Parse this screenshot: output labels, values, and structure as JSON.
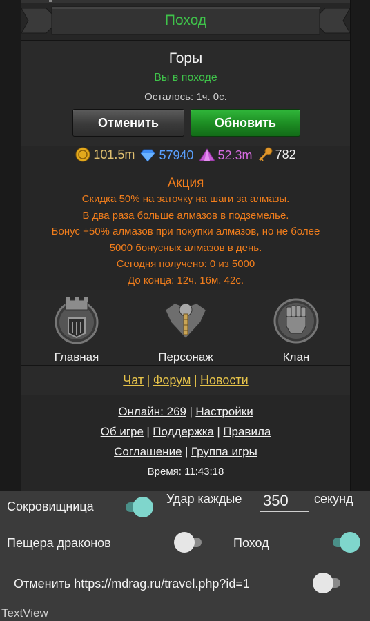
{
  "header": {
    "title": "Поход"
  },
  "travel": {
    "location": "Горы",
    "status": "Вы в походе",
    "remaining": "Осталось: 1ч. 0с.",
    "cancel_label": "Отменить",
    "update_label": "Обновить"
  },
  "currency": {
    "gold": "101.5m",
    "diamonds": "57940",
    "crystals": "52.3m",
    "keys": "782"
  },
  "promo": {
    "title": "Акция",
    "lines": [
      "Скидка 50% на заточку на шаги за алмазы.",
      "В два раза больше алмазов в подземелье.",
      "Бонус +50% алмазов при покупки алмазов, но не более",
      "5000 бонусных алмазов в день.",
      "Сегодня получено: 0 из 5000",
      "До конца: 12ч. 16м. 42с."
    ]
  },
  "nav": {
    "items": [
      {
        "label": "Главная",
        "icon": "castle-icon"
      },
      {
        "label": "Персонаж",
        "icon": "character-icon"
      },
      {
        "label": "Клан",
        "icon": "fist-icon"
      }
    ]
  },
  "links": {
    "chat": "Чат",
    "forum": "Форум",
    "news": "Новости",
    "separator": "|",
    "online": "Онлайн: 269",
    "settings": "Настройки",
    "about": "Об игре",
    "support": "Поддержка",
    "rules": "Правила",
    "agreement": "Соглашение",
    "group": "Группа игры",
    "time": "Время: 11:43:18"
  },
  "panel": {
    "treasury_label": "Сокровищница",
    "treasury_on": true,
    "strike_label": "Удар каждые",
    "strike_value": "350",
    "seconds_label": "секунд",
    "cave_label": "Пещера драконов",
    "cave_on": false,
    "travel_label": "Поход",
    "travel_on": true,
    "cancel_url_label": "Отменить https://mdrag.ru/travel.php?id=1",
    "cancel_url_on": false,
    "textview_label": "TextView"
  },
  "colors": {
    "green_title": "#3fc24a",
    "promo_orange": "#f07d1c",
    "link_yellow": "#e6c34a",
    "toggle_on": "#7fd6cc"
  }
}
